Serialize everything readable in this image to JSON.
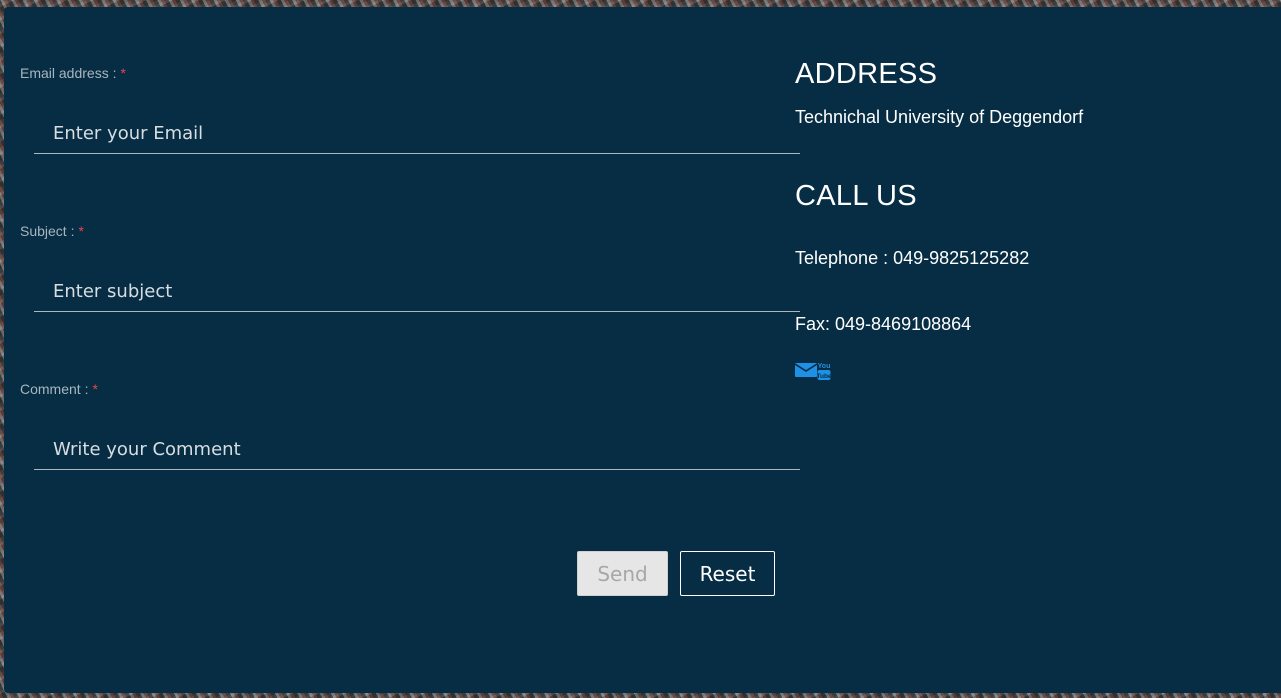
{
  "form": {
    "email": {
      "label": "Email address :",
      "required": "*",
      "placeholder": "Enter your Email"
    },
    "subject": {
      "label": "Subject :",
      "required": "*",
      "placeholder": "Enter subject"
    },
    "comment": {
      "label": "Comment :",
      "required": "*",
      "placeholder": "Write your Comment"
    },
    "send_label": "Send",
    "reset_label": "Reset"
  },
  "contact": {
    "address_heading": "ADDRESS",
    "address_text": "Technichal University of Deggendorf",
    "call_heading": "CALL US",
    "telephone": "Telephone : 049-9825125282",
    "fax": "Fax: 049-8469108864"
  },
  "social": {
    "icons": [
      "envelope-icon",
      "youtube-icon"
    ],
    "youtube_text": "You Tube"
  },
  "colors": {
    "panel_bg": "#062d43",
    "required": "#e8454f",
    "icon_blue": "#1e90e6"
  }
}
